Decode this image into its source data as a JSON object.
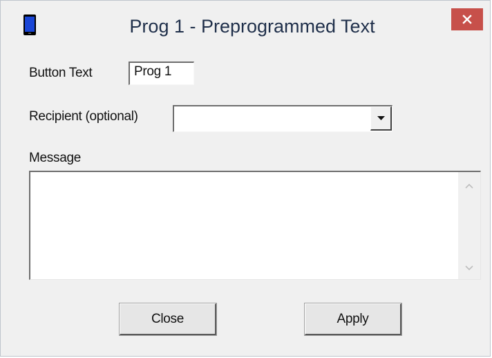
{
  "window": {
    "title": "Prog 1 - Preprogrammed Text",
    "icon": "phone-icon",
    "close_icon": "close-icon",
    "accent_close": "#c7504a"
  },
  "form": {
    "button_text_label": "Button Text",
    "button_text_value": "Prog 1",
    "recipient_label": "Recipient (optional)",
    "recipient_value": "",
    "message_label": "Message",
    "message_value": ""
  },
  "buttons": {
    "close_label": "Close",
    "apply_label": "Apply"
  }
}
